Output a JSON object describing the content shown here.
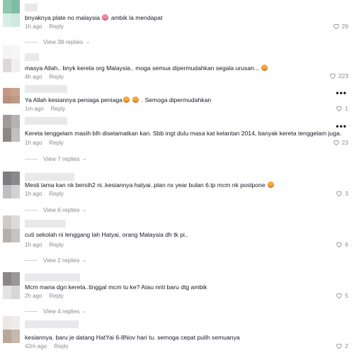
{
  "comments": [
    {
      "text": "bnyaknya plate no malaysia",
      "emoji_after": "😂",
      "text2": "ambik la mendapat",
      "time": "1h ago",
      "reply": "Reply",
      "likes": "29",
      "view_replies": "View 38 replies"
    },
    {
      "text": "masya Allah.. bnyk kereta org Malaysia.. moga semua dipermudahkan segala urusan...",
      "emoji_after": "😥",
      "time": "4h ago",
      "reply": "Reply",
      "likes": "223"
    },
    {
      "text": "Ya Allah kesiannya peniaga peniaga",
      "emoji_after": "😥 😥",
      "text2": ". Semoga dipermudahkan",
      "time": "1m ago",
      "reply": "Reply",
      "likes": "1"
    },
    {
      "text": "Kereta tenggelam masih blh diselamatkan kan. Sbb ingt dulu masa kat kelantan 2014, banyak kereta tenggelam juga.",
      "time": "1h ago",
      "reply": "Reply",
      "likes": "23",
      "view_replies": "View 7 replies"
    },
    {
      "text": "Mesti lama kan nk bersih2 ni..kesiannya hatyai..plan nx year bulan 6.tp mcm nk postpone",
      "emoji_after": "😥",
      "time": "1h ago",
      "reply": "Reply",
      "likes": "3",
      "view_replies": "View 6 replies"
    },
    {
      "text": "cuti sekolah ni lenggang lah Hatyai, orang Malaysia dh tk pi..",
      "time": "1h ago",
      "reply": "Reply",
      "likes": "6",
      "view_replies": "View 2 replies"
    },
    {
      "text": "Mcm mana dgn kereta..tinggal mcm tu ke? Atau nnti baru dtg ambik",
      "time": "2h ago",
      "reply": "Reply",
      "likes": "5",
      "view_replies": "View 4 replies"
    },
    {
      "text": "kesiannya. baru je datang HatYai 6-8Nov hari tu. semoga cepat pulih semuanya",
      "time": "42m ago",
      "reply": "Reply",
      "likes": "2"
    }
  ],
  "colors": {
    "meta": "#8a8b91",
    "text": "#161823"
  }
}
